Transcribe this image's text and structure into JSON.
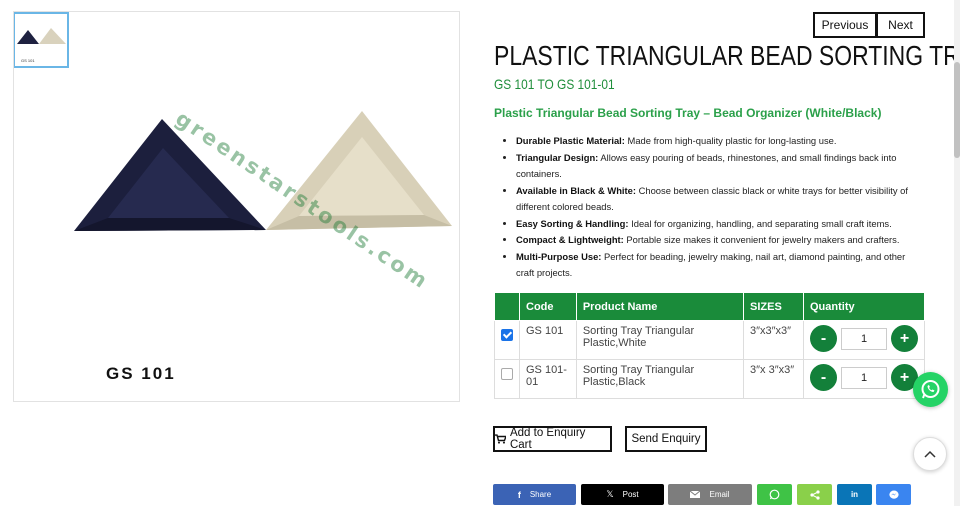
{
  "gallery": {
    "thumb_caption": "GS 101",
    "image_caption": "GS 101",
    "watermark": "greenstarstools.com"
  },
  "nav": {
    "previous": "Previous",
    "next": "Next"
  },
  "product": {
    "title": "PLASTIC TRIANGULAR BEAD SORTING TRAY",
    "codes": "GS 101 TO GS 101-01",
    "subtitle": "Plastic Triangular Bead Sorting Tray – Bead Organizer (White/Black)",
    "features": [
      {
        "label": "Durable Plastic Material:",
        "text": " Made from high-quality plastic for long-lasting use."
      },
      {
        "label": "Triangular Design:",
        "text": " Allows easy pouring of beads, rhinestones, and small findings back into containers."
      },
      {
        "label": "Available in Black & White:",
        "text": " Choose between classic black or white trays for better visibility of different colored beads."
      },
      {
        "label": "Easy Sorting & Handling:",
        "text": " Ideal for organizing, handling, and separating small craft items."
      },
      {
        "label": "Compact & Lightweight:",
        "text": " Portable size makes it convenient for jewelry makers and crafters."
      },
      {
        "label": "Multi-Purpose Use:",
        "text": " Perfect for beading, jewelry making, nail art, diamond painting, and other craft projects."
      }
    ]
  },
  "table": {
    "headers": {
      "code": "Code",
      "name": "Product Name",
      "sizes": "SIZES",
      "quantity": "Quantity"
    },
    "rows": [
      {
        "checked": true,
        "code": "GS 101",
        "name": "Sorting Tray Triangular Plastic,White",
        "size": "3″x3″x3″",
        "qty": "1"
      },
      {
        "checked": false,
        "code": "GS 101-01",
        "name": "Sorting Tray Triangular Plastic,Black",
        "size": "3″x 3″x3″",
        "qty": "1"
      }
    ],
    "minus": "-",
    "plus": "+"
  },
  "actions": {
    "add_to_cart": "Add to Enquiry Cart",
    "send_enquiry": "Send Enquiry"
  },
  "share": {
    "facebook": "Share",
    "x": "Post",
    "email": "Email",
    "colors": {
      "facebook": "#3b63b5",
      "x": "#000000",
      "email": "#7d7d7d",
      "whatsapp": "#3fc346",
      "sharethis": "#8ad04a",
      "linkedin": "#0a75b7",
      "messenger": "#3a85f0"
    }
  },
  "colors": {
    "accent_green": "#1a8b3a",
    "title": "#111111"
  }
}
